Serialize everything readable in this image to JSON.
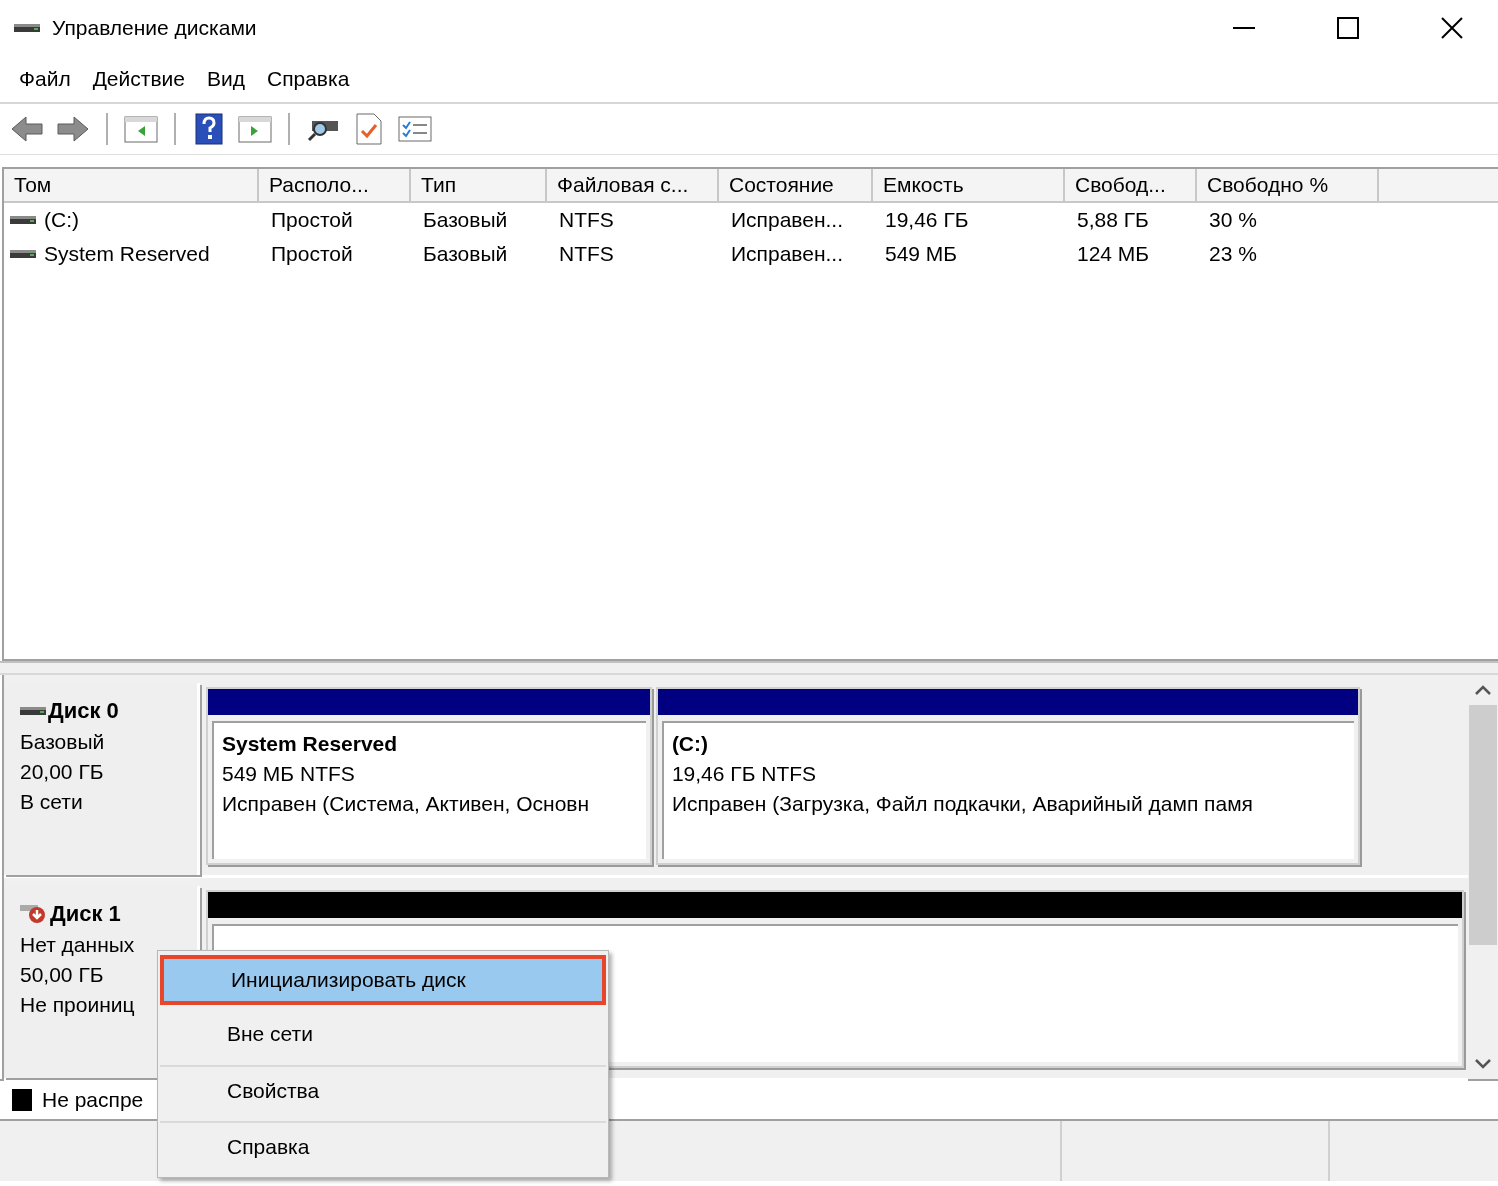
{
  "window": {
    "title": "Управление дисками"
  },
  "menu": [
    "Файл",
    "Действие",
    "Вид",
    "Справка"
  ],
  "table": {
    "columns": [
      "Том",
      "Располо...",
      "Тип",
      "Файловая с...",
      "Состояние",
      "Емкость",
      "Свобод...",
      "Свободно %"
    ],
    "rows": [
      {
        "cells": [
          "(C:)",
          "Простой",
          "Базовый",
          "NTFS",
          "Исправен...",
          "19,46 ГБ",
          "5,88 ГБ",
          "30 %"
        ]
      },
      {
        "cells": [
          "System Reserved",
          "Простой",
          "Базовый",
          "NTFS",
          "Исправен...",
          "549 МБ",
          "124 МБ",
          "23 %"
        ]
      }
    ]
  },
  "disks": [
    {
      "name": "Диск 0",
      "kind": "online",
      "lines": [
        "Базовый",
        "20,00 ГБ",
        "В сети"
      ],
      "partitions": [
        {
          "name": "System Reserved",
          "size": "549 МБ NTFS",
          "status": "Исправен (Система, Активен, Основн",
          "color": "#000080"
        },
        {
          "name": "(C:)",
          "size": "19,46 ГБ NTFS",
          "status": "Исправен (Загрузка, Файл подкачки, Аварийный дамп памя",
          "color": "#000080"
        }
      ]
    },
    {
      "name": "Диск 1",
      "kind": "uninitialized",
      "lines": [
        "Нет данных",
        "50,00 ГБ",
        "Не проиниц"
      ],
      "partitions": [
        {
          "color": "#000000"
        }
      ]
    }
  ],
  "legend": [
    {
      "label": "Не распре",
      "color": "#000000"
    }
  ],
  "context_menu": [
    {
      "label": "Инициализировать диск",
      "selected": true,
      "separator_above": false
    },
    {
      "label": "Вне сети",
      "selected": false,
      "separator_above": false
    },
    {
      "label": "Свойства",
      "selected": false,
      "separator_above": true
    },
    {
      "label": "Справка",
      "selected": false,
      "separator_above": true
    }
  ]
}
